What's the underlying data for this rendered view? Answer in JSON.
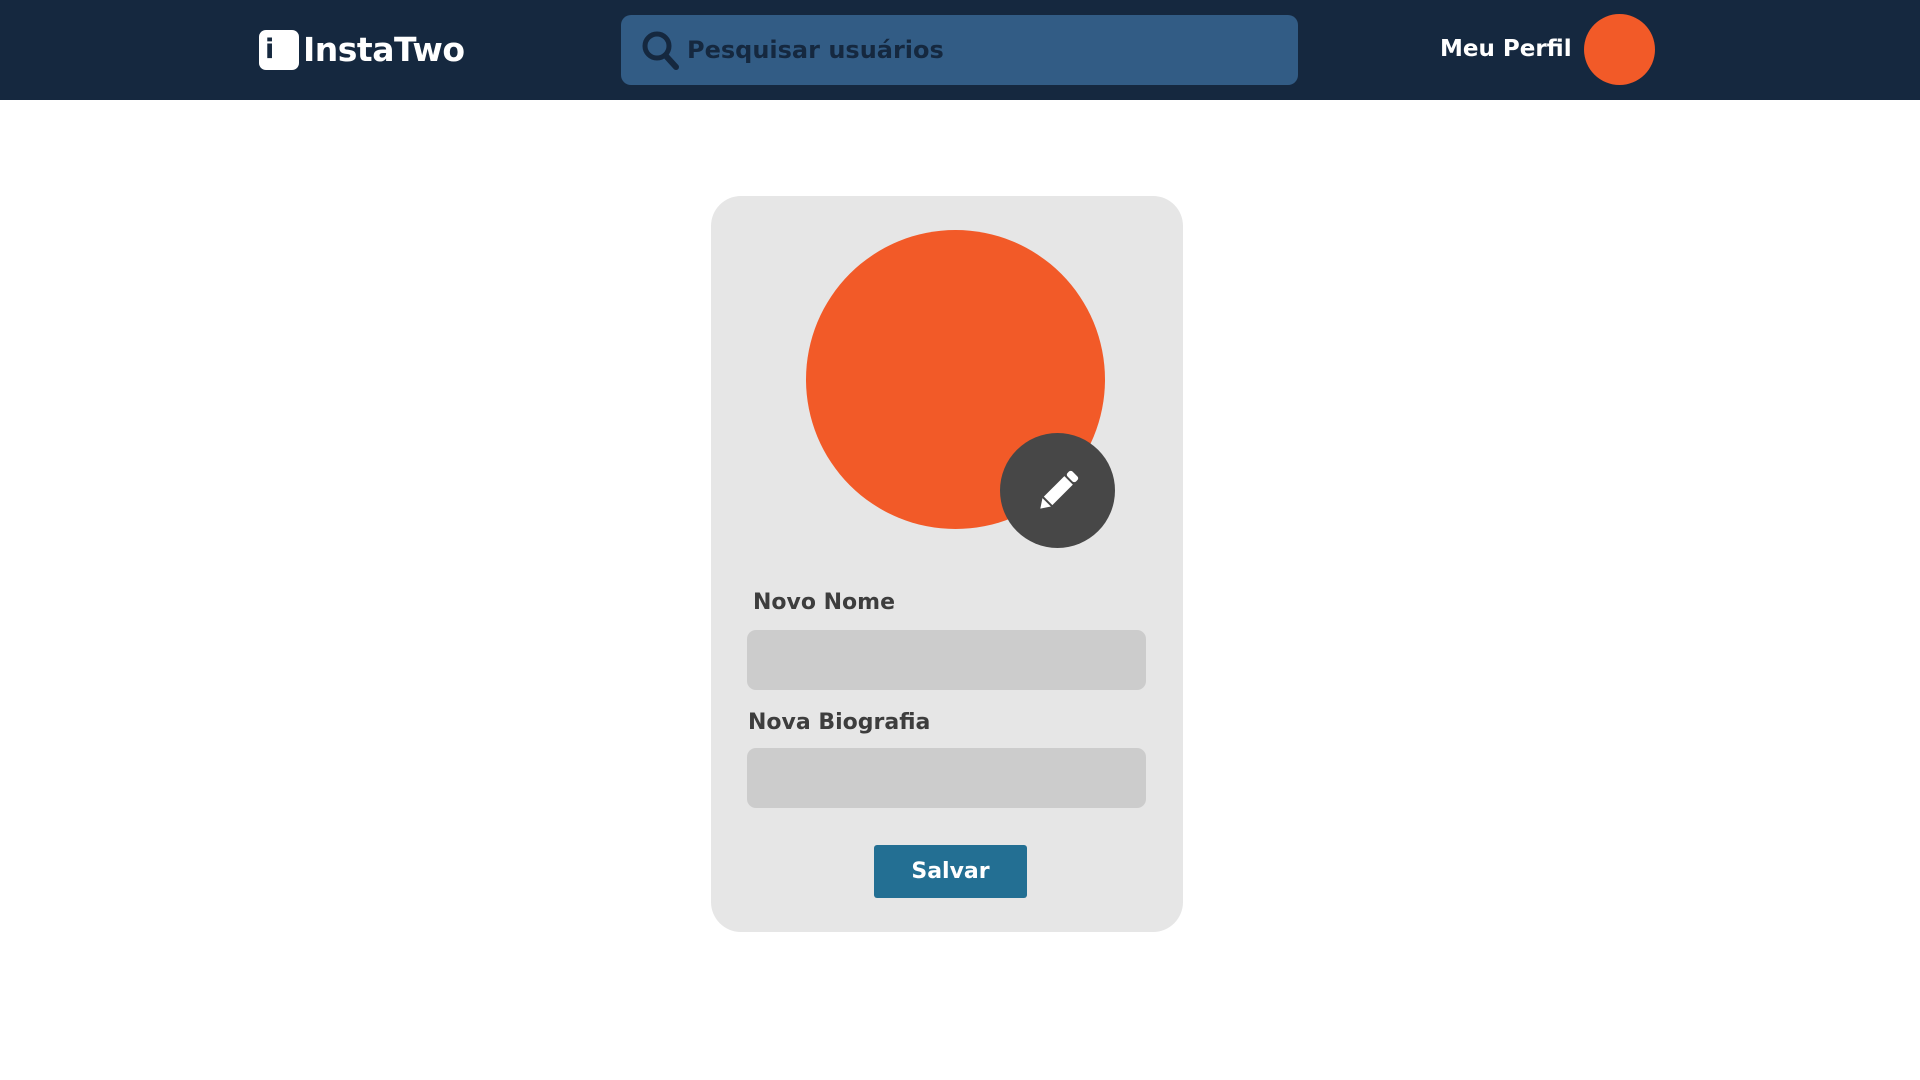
{
  "header": {
    "logo": {
      "icon": "instatwo-logo-icon",
      "icon_letter": "i",
      "name": "InstaTwo"
    },
    "search": {
      "icon": "search-icon",
      "placeholder": "Pesquisar usuários",
      "value": ""
    },
    "profile_link": {
      "label": "Meu Perfil",
      "avatar_icon": "avatar"
    }
  },
  "edit_profile": {
    "avatar_icon": "avatar",
    "edit_photo_icon": "pencil-icon",
    "name_label": "Novo Nome",
    "name_value": "",
    "bio_label": "Nova Biografia",
    "bio_value": "",
    "save_label": "Salvar"
  },
  "colors": {
    "header_bg": "#15283f",
    "search_bg": "#325c85",
    "avatar": "#f25a28",
    "card_bg": "#e6e6e6",
    "input_bg": "#cccccc",
    "edit_button_bg": "#474747",
    "save_button_bg": "#236f93",
    "label_text": "#3d3d3d"
  }
}
